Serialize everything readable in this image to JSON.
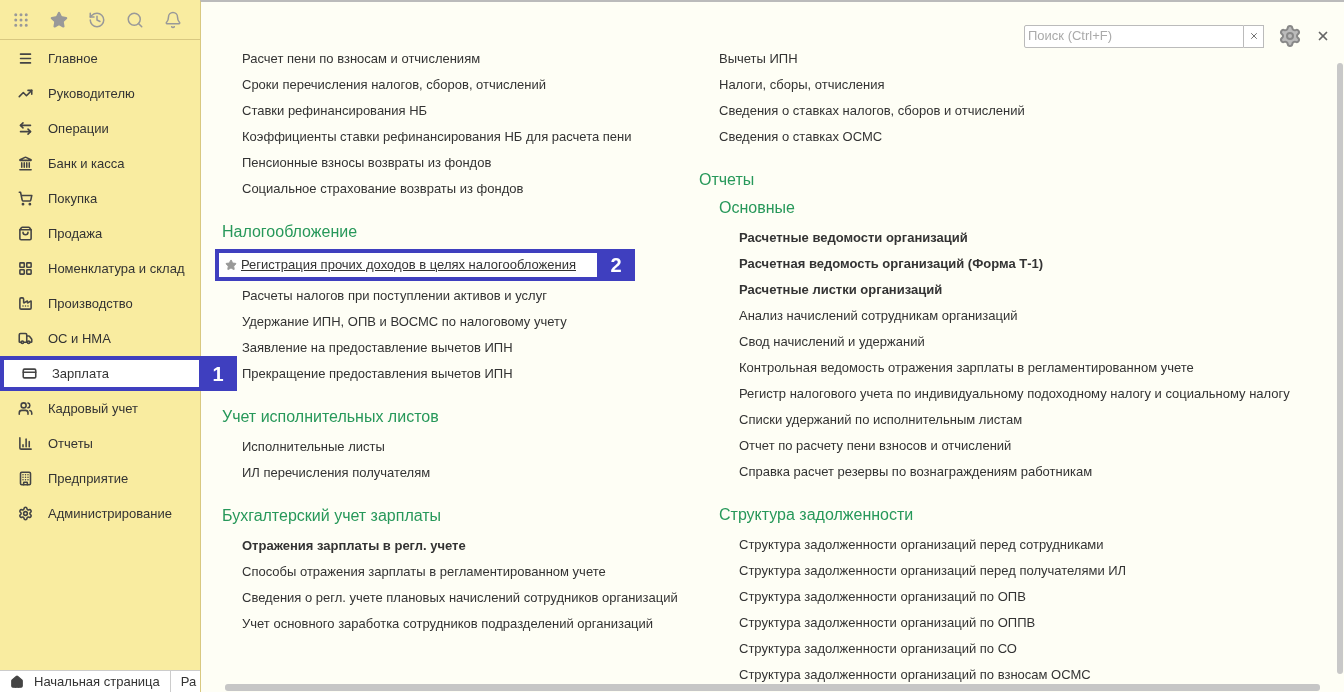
{
  "sidebar": {
    "items": [
      {
        "label": "Главное",
        "selected": false
      },
      {
        "label": "Руководителю",
        "selected": false
      },
      {
        "label": "Операции",
        "selected": false
      },
      {
        "label": "Банк и касса",
        "selected": false
      },
      {
        "label": "Покупка",
        "selected": false
      },
      {
        "label": "Продажа",
        "selected": false
      },
      {
        "label": "Номенклатура и склад",
        "selected": false
      },
      {
        "label": "Производство",
        "selected": false
      },
      {
        "label": "ОС и НМА",
        "selected": false
      },
      {
        "label": "Зарплата",
        "selected": true,
        "callout": "1"
      },
      {
        "label": "Кадровый учет",
        "selected": false
      },
      {
        "label": "Отчеты",
        "selected": false
      },
      {
        "label": "Предприятие",
        "selected": false
      },
      {
        "label": "Администрирование",
        "selected": false
      }
    ]
  },
  "open_tabs": [
    {
      "label": "Начальная страница"
    },
    {
      "label": "Ра"
    }
  ],
  "search": {
    "placeholder": "Поиск (Ctrl+F)"
  },
  "left_column": [
    {
      "items": [
        {
          "text": "Расчет пени по взносам и отчислениям",
          "bold": false,
          "focused": false
        },
        {
          "text": "Сроки перечисления налогов, сборов, отчислений",
          "bold": false,
          "focused": false
        },
        {
          "text": "Ставки рефинансирования НБ",
          "bold": false,
          "focused": false
        },
        {
          "text": "Коэффициенты ставки рефинансирования НБ для расчета пени",
          "bold": false,
          "focused": false
        },
        {
          "text": "Пенсионные взносы возвраты из фондов",
          "bold": false,
          "focused": false
        },
        {
          "text": "Социальное страхование возвраты из фондов",
          "bold": false,
          "focused": false
        }
      ]
    },
    {
      "heading": "Налогообложение",
      "items": [
        {
          "text": "Регистрация прочих доходов в целях налогообложения",
          "bold": false,
          "focused": true,
          "callout": "2"
        },
        {
          "text": "Расчеты налогов при поступлении активов и услуг",
          "bold": false,
          "focused": false
        },
        {
          "text": "Удержание ИПН, ОПВ и ВОСМС по налоговому учету",
          "bold": false,
          "focused": false
        },
        {
          "text": "Заявление на предоставление вычетов ИПН",
          "bold": false,
          "focused": false
        },
        {
          "text": "Прекращение предоставления вычетов ИПН",
          "bold": false,
          "focused": false
        }
      ]
    },
    {
      "heading": "Учет исполнительных листов",
      "items": [
        {
          "text": "Исполнительные листы",
          "bold": false,
          "focused": false
        },
        {
          "text": "ИЛ перечисления получателям",
          "bold": false,
          "focused": false
        }
      ]
    },
    {
      "heading": "Бухгалтерский учет зарплаты",
      "items": [
        {
          "text": "Отражения зарплаты в регл. учете",
          "bold": true,
          "focused": false
        },
        {
          "text": "Способы отражения зарплаты в регламентированном учете",
          "bold": false,
          "focused": false
        },
        {
          "text": "Сведения о регл. учете плановых начислений сотрудников организаций",
          "bold": false,
          "focused": false
        },
        {
          "text": "Учет основного заработка сотрудников подразделений организаций",
          "bold": false,
          "focused": false
        }
      ]
    }
  ],
  "right_column": [
    {
      "items": [
        {
          "text": "Вычеты ИПН",
          "bold": false
        },
        {
          "text": "Налоги, сборы, отчисления",
          "bold": false
        },
        {
          "text": "Сведения о ставках налогов, сборов и отчислений",
          "bold": false
        },
        {
          "text": "Сведения о ставках ОСМС",
          "bold": false
        }
      ]
    },
    {
      "heading": "Отчеты",
      "subsections": [
        {
          "heading": "Основные",
          "items": [
            {
              "text": "Расчетные ведомости организаций",
              "bold": true
            },
            {
              "text": "Расчетная ведомость организаций (Форма Т-1)",
              "bold": true
            },
            {
              "text": "Расчетные листки организаций",
              "bold": true
            },
            {
              "text": "Анализ начислений сотрудникам организаций",
              "bold": false
            },
            {
              "text": "Свод начислений и удержаний",
              "bold": false
            },
            {
              "text": "Контрольная ведомость отражения зарплаты в регламентированном учете",
              "bold": false
            },
            {
              "text": "Регистр налогового учета по индивидуальному подоходному налогу и социальному налогу",
              "bold": false
            },
            {
              "text": "Списки удержаний по исполнительным листам",
              "bold": false
            },
            {
              "text": "Отчет по расчету пени взносов и отчислений",
              "bold": false
            },
            {
              "text": "Справка расчет резервы по вознаграждениям работникам",
              "bold": false
            }
          ]
        },
        {
          "heading": "Структура задолженности",
          "items": [
            {
              "text": "Структура задолженности организаций перед сотрудниками",
              "bold": false
            },
            {
              "text": "Структура задолженности организаций перед получателями ИЛ",
              "bold": false
            },
            {
              "text": "Структура задолженности организаций по ОПВ",
              "bold": false
            },
            {
              "text": "Структура задолженности организаций по ОППВ",
              "bold": false
            },
            {
              "text": "Структура задолженности организаций по СО",
              "bold": false
            },
            {
              "text": "Структура задолженности организаций по взносам ОСМС",
              "bold": false
            }
          ]
        }
      ]
    }
  ]
}
